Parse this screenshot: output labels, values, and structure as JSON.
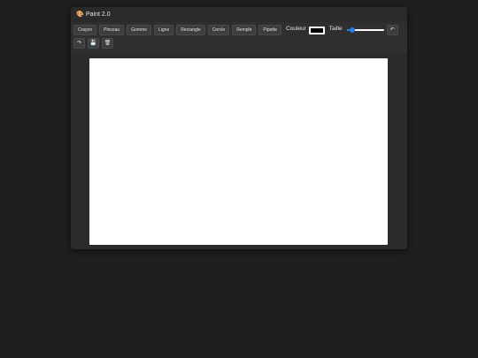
{
  "window": {
    "title": "Paint 2.0",
    "title_icon": "palette-icon"
  },
  "toolbar": {
    "tools": [
      {
        "label": "Crayon"
      },
      {
        "label": "Pinceau"
      },
      {
        "label": "Gomme"
      },
      {
        "label": "Ligne"
      },
      {
        "label": "Rectangle"
      },
      {
        "label": "Cercle"
      },
      {
        "label": "Remplir"
      },
      {
        "label": "Pipette"
      }
    ],
    "color_label": "Couleur",
    "color_value": "#000000",
    "size_label": "Taille",
    "size_level_fraction": 0.1,
    "undo_icon": "undo-icon",
    "redo_icon": "redo-icon",
    "save_icon": "save-icon",
    "clear_icon": "trash-icon"
  },
  "canvas": {
    "background": "#ffffff"
  }
}
